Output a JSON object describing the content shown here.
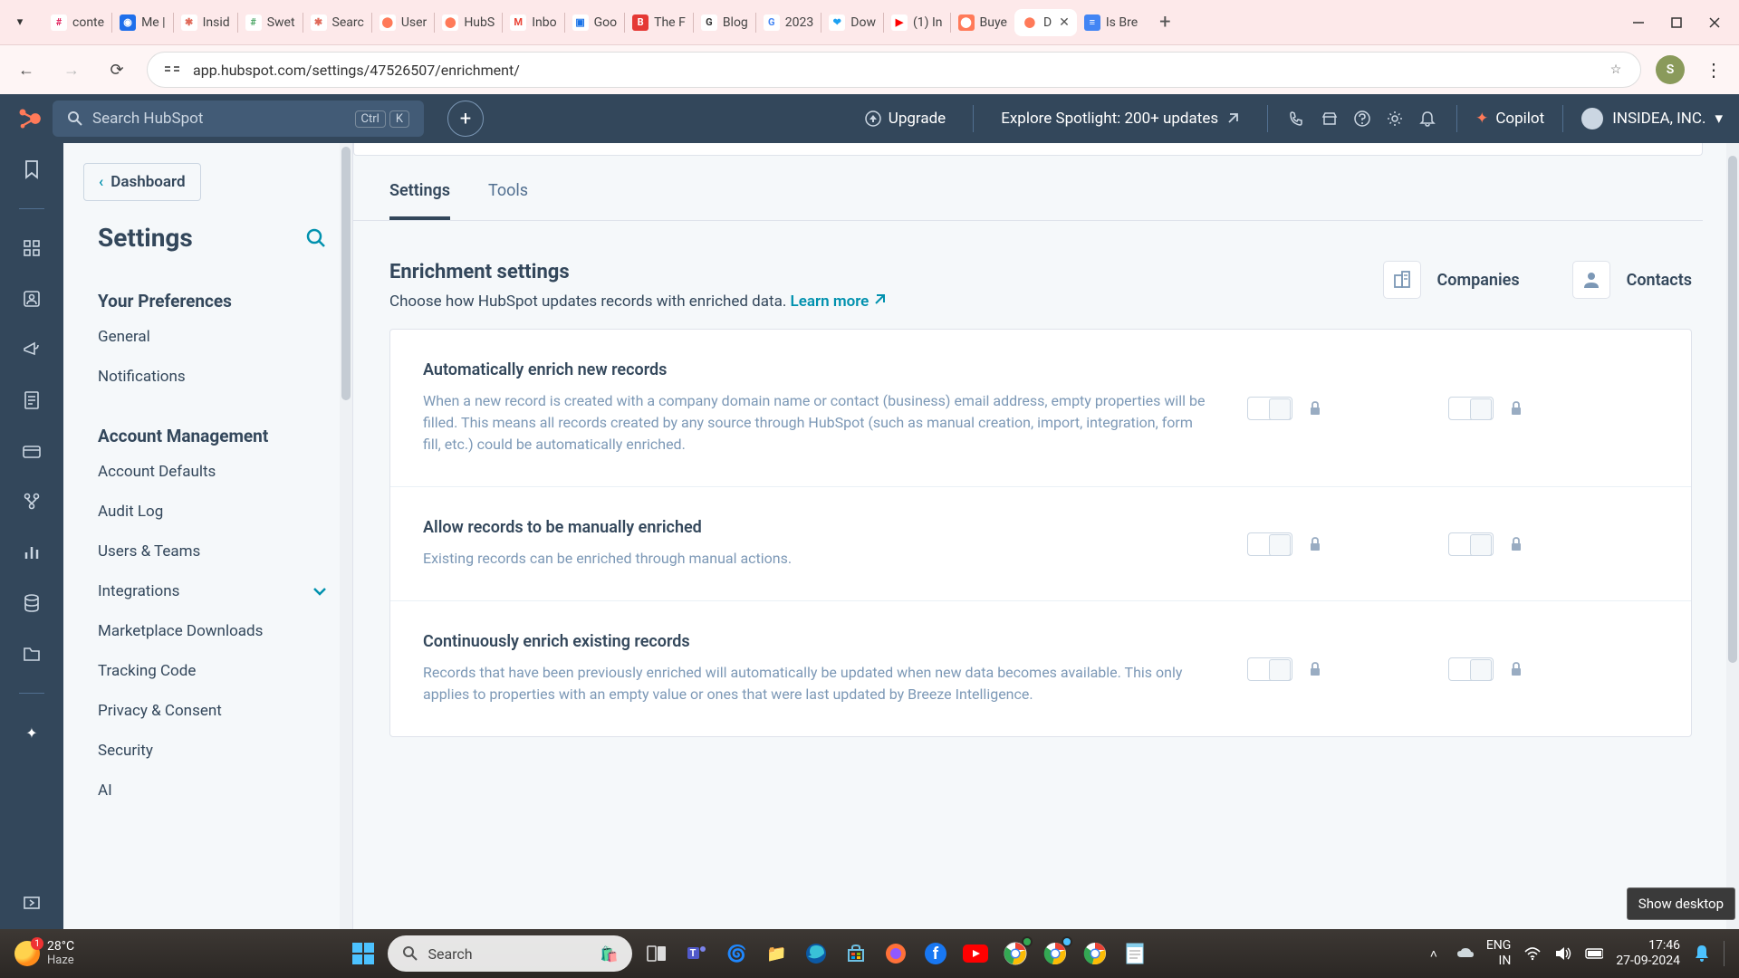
{
  "browser": {
    "tabs": [
      {
        "label": "conte",
        "iconBg": "#fff",
        "iconFg": "#e01e5a",
        "initial": "#"
      },
      {
        "label": "Me |",
        "iconBg": "#1f6feb",
        "iconFg": "#fff",
        "initial": "◉"
      },
      {
        "label": "Insid",
        "iconBg": "#fff",
        "iconFg": "#e06a5a",
        "initial": "✱"
      },
      {
        "label": "Swet",
        "iconBg": "#fff",
        "iconFg": "#4aa564",
        "initial": "#"
      },
      {
        "label": "Searc",
        "iconBg": "#fff",
        "iconFg": "#e06a5a",
        "initial": "✱"
      },
      {
        "label": "User",
        "iconBg": "#fff",
        "iconFg": "#ff7a59",
        "initial": "⬤"
      },
      {
        "label": "HubS",
        "iconBg": "#fff",
        "iconFg": "#ff7a59",
        "initial": "⬤"
      },
      {
        "label": "Inbo",
        "iconBg": "#fff",
        "iconFg": "#ea4335",
        "initial": "M"
      },
      {
        "label": "Goo",
        "iconBg": "#fff",
        "iconFg": "#1a73e8",
        "initial": "▣"
      },
      {
        "label": "The F",
        "iconBg": "#e53935",
        "iconFg": "#fff",
        "initial": "B"
      },
      {
        "label": "Blog",
        "iconBg": "#fff",
        "iconFg": "#333",
        "initial": "G"
      },
      {
        "label": "2023",
        "iconBg": "#fff",
        "iconFg": "#4285f4",
        "initial": "G"
      },
      {
        "label": "Dow",
        "iconBg": "#fff",
        "iconFg": "#1da1f2",
        "initial": "❤"
      },
      {
        "label": "(1) In",
        "iconBg": "#fff",
        "iconFg": "#ff0000",
        "initial": "▶"
      },
      {
        "label": "Buye",
        "iconBg": "#ff7a59",
        "iconFg": "#fff",
        "initial": "⬤"
      },
      {
        "label": "D",
        "iconBg": "#fff",
        "iconFg": "#ff7a59",
        "initial": "⬤",
        "active": true
      },
      {
        "label": "Is Bre",
        "iconBg": "#4285f4",
        "iconFg": "#fff",
        "initial": "≡"
      }
    ],
    "url": "app.hubspot.com/settings/47526507/enrichment/",
    "profileInitial": "S"
  },
  "hs": {
    "searchPlaceholder": "Search HubSpot",
    "searchKbd1": "Ctrl",
    "searchKbd2": "K",
    "upgrade": "Upgrade",
    "spotlight": "Explore Spotlight: 200+ updates",
    "copilot": "Copilot",
    "account": "INSIDEA, INC."
  },
  "sidebar": {
    "back": "Dashboard",
    "title": "Settings",
    "sectionA": "Your Preferences",
    "itemsA": [
      "General",
      "Notifications"
    ],
    "sectionB": "Account Management",
    "itemsB": [
      "Account Defaults",
      "Audit Log",
      "Users & Teams",
      "Integrations",
      "Marketplace Downloads",
      "Tracking Code",
      "Privacy & Consent",
      "Security",
      "AI"
    ]
  },
  "tabs": {
    "settings": "Settings",
    "tools": "Tools"
  },
  "enrichment": {
    "title": "Enrichment settings",
    "subtitle": "Choose how HubSpot updates records with enriched data.",
    "learnMore": "Learn more",
    "companies": "Companies",
    "contacts": "Contacts",
    "rows": [
      {
        "title": "Automatically enrich new records",
        "desc": "When a new record is created with a company domain name or contact (business) email address, empty properties will be filled. This means all records created by any source through HubSpot (such as manual creation, import, integration, form fill, etc.) could be automatically enriched."
      },
      {
        "title": "Allow records to be manually enriched",
        "desc": "Existing records can be enriched through manual actions."
      },
      {
        "title": "Continuously enrich existing records",
        "desc": "Records that have been previously enriched will automatically be updated when new data becomes available. This only applies to properties with an empty value or ones that were last updated by Breeze Intelligence."
      }
    ]
  },
  "tooltip": "Show desktop",
  "taskbar": {
    "temp": "28°C",
    "cond": "Haze",
    "searchPlaceholder": "Search",
    "lang1": "ENG",
    "lang2": "IN",
    "time": "17:46",
    "date": "27-09-2024"
  }
}
